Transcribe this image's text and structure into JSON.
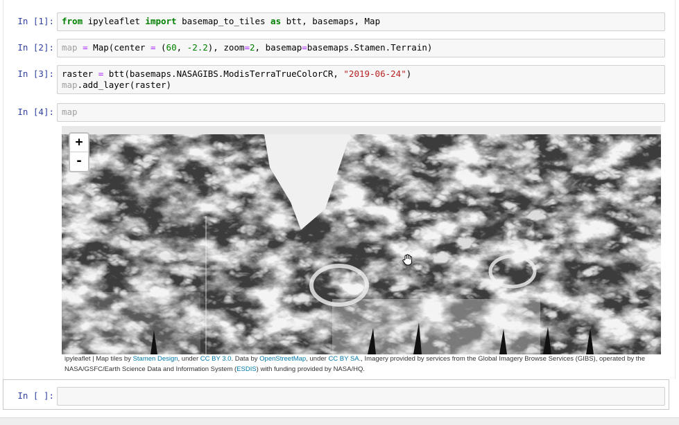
{
  "cells": [
    {
      "prompt": "In [1]:",
      "tokens": [
        {
          "t": "from",
          "c": "kw"
        },
        {
          "t": " ipyleaflet ",
          "c": ""
        },
        {
          "t": "import",
          "c": "kw"
        },
        {
          "t": " basemap_to_tiles ",
          "c": ""
        },
        {
          "t": "as",
          "c": "kw"
        },
        {
          "t": " btt, basemaps, Map",
          "c": ""
        }
      ]
    },
    {
      "prompt": "In [2]:",
      "tokens": [
        {
          "t": "map",
          "c": "var"
        },
        {
          "t": " ",
          "c": ""
        },
        {
          "t": "=",
          "c": "op"
        },
        {
          "t": " Map(center ",
          "c": ""
        },
        {
          "t": "=",
          "c": "op"
        },
        {
          "t": " (",
          "c": ""
        },
        {
          "t": "60",
          "c": "num"
        },
        {
          "t": ", ",
          "c": ""
        },
        {
          "t": "-2.2",
          "c": "num"
        },
        {
          "t": "), zoom",
          "c": ""
        },
        {
          "t": "=",
          "c": "op"
        },
        {
          "t": "2",
          "c": "num"
        },
        {
          "t": ", basemap",
          "c": ""
        },
        {
          "t": "=",
          "c": "op"
        },
        {
          "t": "basemaps.Stamen.Terrain)",
          "c": ""
        }
      ]
    },
    {
      "prompt": "In [3]:",
      "tokens": [
        {
          "t": "raster ",
          "c": ""
        },
        {
          "t": "=",
          "c": "op"
        },
        {
          "t": " btt(basemaps.NASAGIBS.ModisTerraTrueColorCR, ",
          "c": ""
        },
        {
          "t": "\"2019-06-24\"",
          "c": "str"
        },
        {
          "t": ")",
          "c": ""
        }
      ],
      "tokens2": [
        {
          "t": "map",
          "c": "var"
        },
        {
          "t": ".add_layer(raster)",
          "c": ""
        }
      ]
    },
    {
      "prompt": "In [4]:",
      "tokens": [
        {
          "t": "map",
          "c": "var"
        }
      ]
    }
  ],
  "empty_cell": {
    "prompt": "In [ ]:"
  },
  "map": {
    "zoom_in": "+",
    "zoom_out": "-"
  },
  "attribution": {
    "p1": "ipyleaflet | Map tiles by ",
    "l1": "Stamen Design",
    "p2": ", under ",
    "l2": "CC BY 3.0",
    "p3": ". Data by ",
    "l3": "OpenStreetMap",
    "p4": ", under ",
    "l4": "CC BY SA",
    "p5": "., Imagery provided by services from the Global Imagery Browse Services (GIBS), operated by the NASA/GSFC/Earth Science Data and Information System (",
    "l5": "ESDIS",
    "p6": ") with funding provided by NASA/HQ."
  }
}
